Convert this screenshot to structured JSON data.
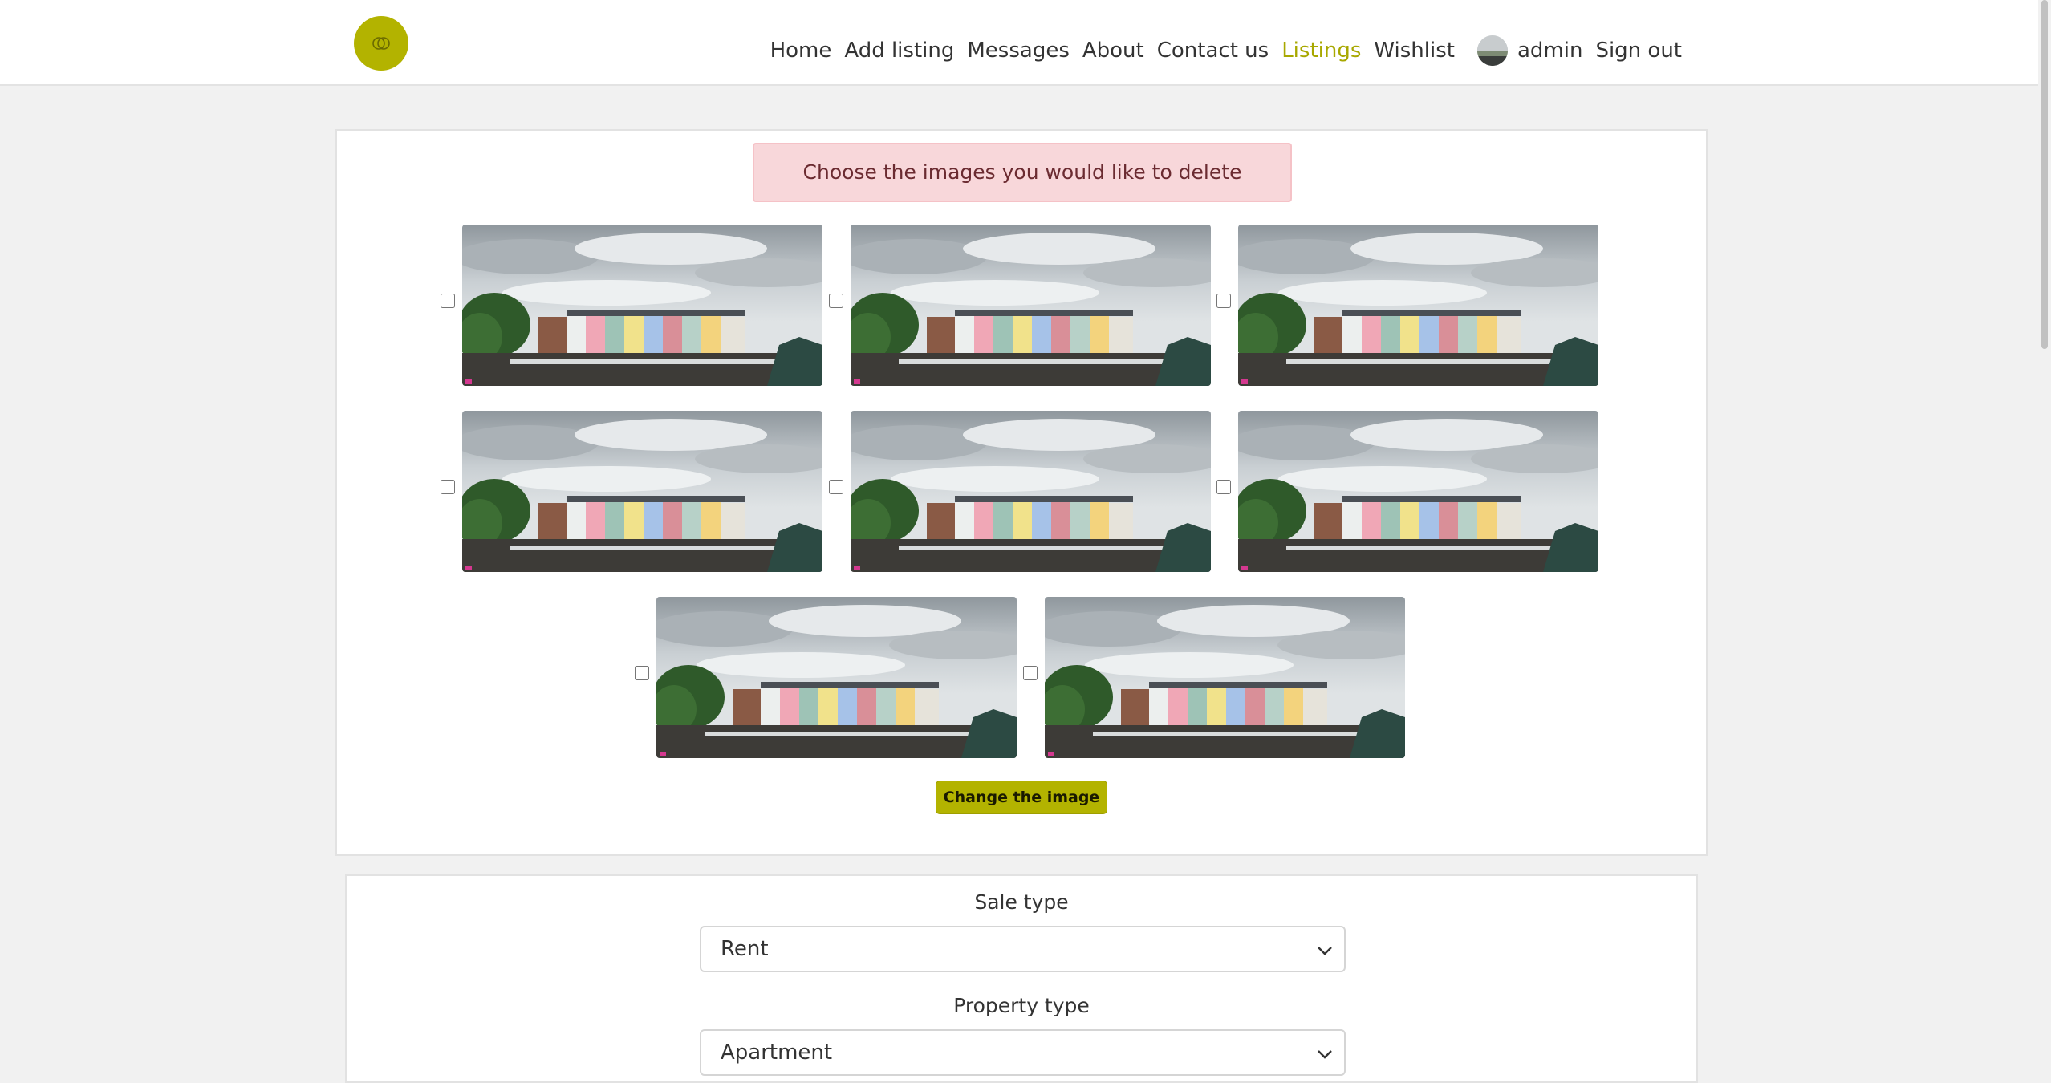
{
  "nav": {
    "items": [
      "Home",
      "Add listing",
      "Messages",
      "About",
      "Contact us",
      "Listings",
      "Wishlist"
    ],
    "active": "Listings",
    "user": "admin",
    "signout": "Sign out"
  },
  "alert": "Choose the images you would like to delete",
  "images_count": 8,
  "change_button": "Change the image",
  "form": {
    "sale_type_label": "Sale type",
    "sale_type_value": "Rent",
    "property_type_label": "Property type",
    "property_type_value": "Apartment"
  },
  "colors": {
    "accent": "#b3b300",
    "alert_bg": "#f8d7da",
    "alert_text": "#6b2b31"
  }
}
